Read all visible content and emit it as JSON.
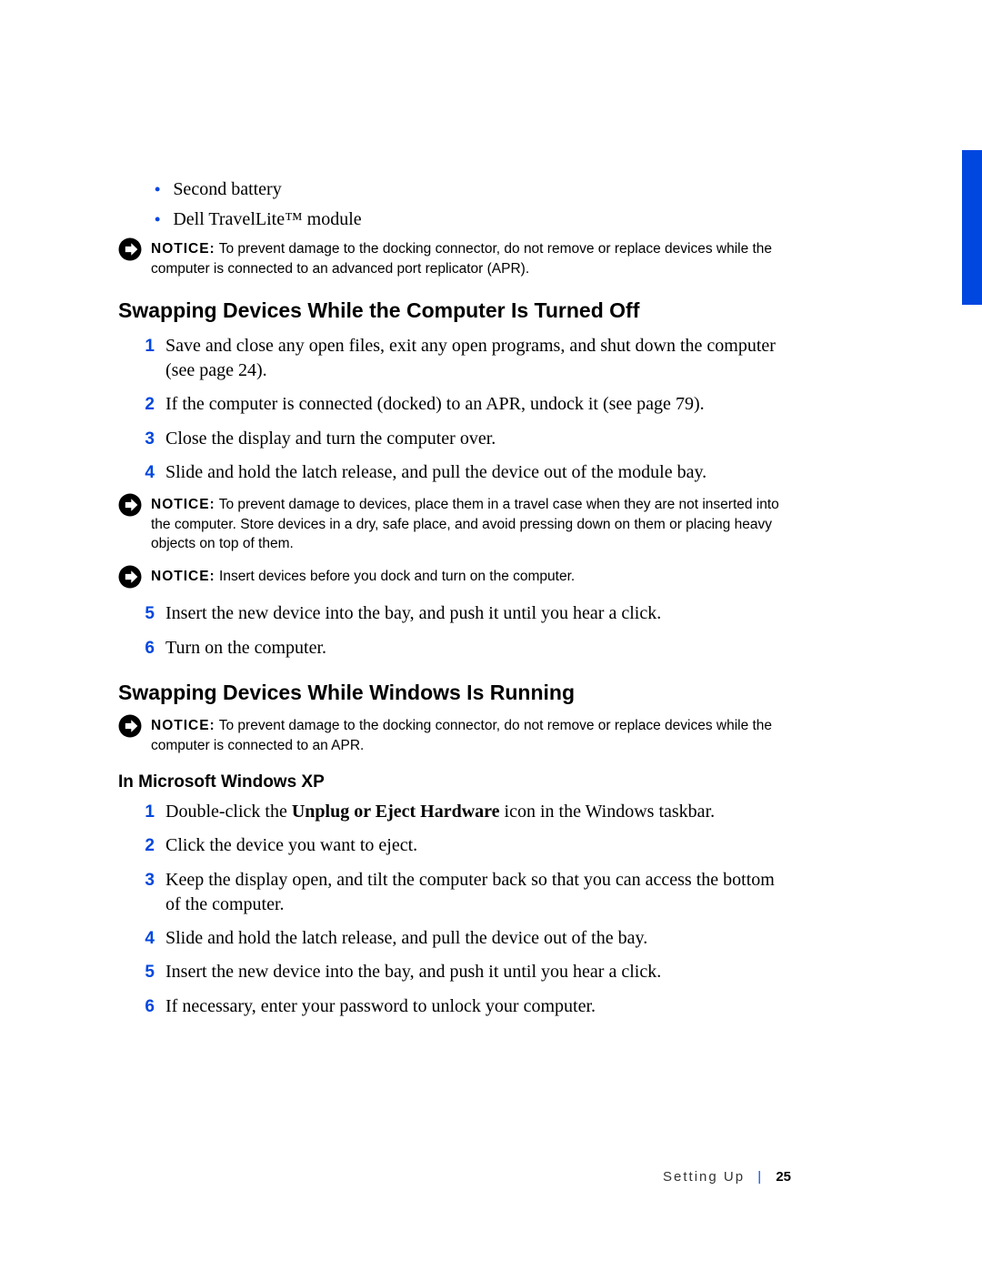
{
  "bullets": {
    "item1": "Second battery",
    "item2": "Dell TravelLite™ module"
  },
  "notices": {
    "label": "NOTICE:",
    "n1": " To prevent damage to the docking connector, do not remove or replace devices while the computer is connected to an advanced port replicator (APR).",
    "n2": " To prevent damage to devices, place them in a travel case when they are not inserted into the computer. Store devices in a dry, safe place, and avoid pressing down on them or placing heavy objects on top of them.",
    "n3": " Insert devices before you dock and turn on the computer.",
    "n4": " To prevent damage to the docking connector, do not remove or replace devices while the computer is connected to an APR."
  },
  "headings": {
    "h1": "Swapping Devices While the Computer Is Turned Off",
    "h2": "Swapping Devices While Windows Is Running",
    "h3": "In Microsoft Windows XP"
  },
  "steps_off": {
    "s1": "Save and close any open files, exit any open programs, and shut down the computer (see page 24).",
    "s2": "If the computer is connected (docked) to an APR, undock it (see page 79).",
    "s3": "Close the display and turn the computer over.",
    "s4": "Slide and hold the latch release, and pull the device out of the module bay.",
    "s5": "Insert the new device into the bay, and push it until you hear a click.",
    "s6": "Turn on the computer."
  },
  "steps_xp": {
    "s1a": "Double-click the ",
    "s1b": "Unplug or Eject Hardware",
    "s1c": " icon in the Windows taskbar.",
    "s2": "Click the device you want to eject.",
    "s3": "Keep the display open, and tilt the computer back so that you can access the bottom of the computer.",
    "s4": "Slide and hold the latch release, and pull the device out of the bay.",
    "s5": "Insert the new device into the bay, and push it until you hear a click.",
    "s6": "If necessary, enter your password to unlock your computer."
  },
  "nums": {
    "n1": "1",
    "n2": "2",
    "n3": "3",
    "n4": "4",
    "n5": "5",
    "n6": "6"
  },
  "footer": {
    "section": "Setting Up",
    "sep": "|",
    "page": "25"
  }
}
